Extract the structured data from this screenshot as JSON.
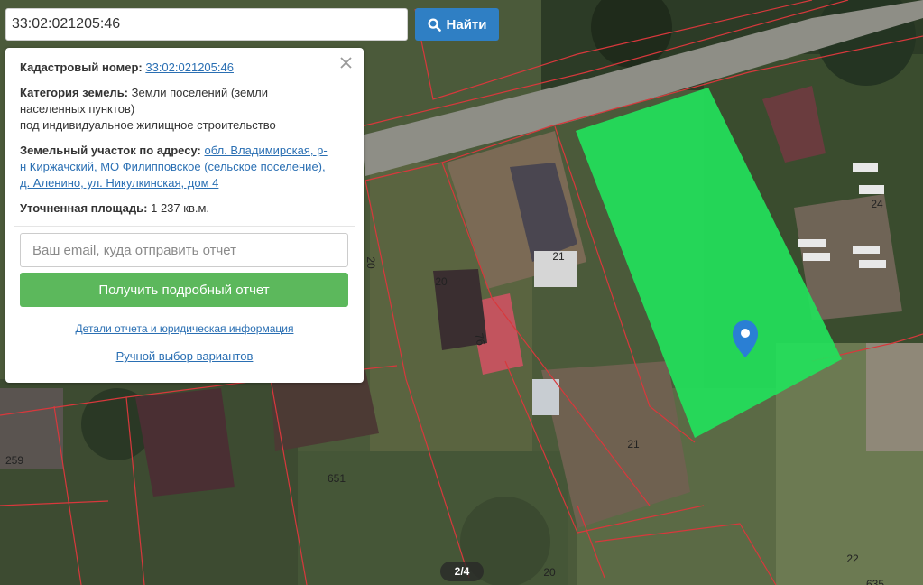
{
  "search": {
    "value": "33:02:021205:46",
    "button_label": "Найти"
  },
  "panel": {
    "cadastral_label": "Кадастровый номер:",
    "cadastral_value": "33:02:021205:46",
    "category_label": "Категория земель:",
    "category_value_line1": "Земли поселений (земли",
    "category_value_line2": "населенных пунктов)",
    "category_value_line3": "под индивидуальное жилищное строительство",
    "address_label": "Земельный участок по адресу:",
    "address_line1": "обл. Владимирская, р-",
    "address_line2": "н Киржачский, МО Филипповское (сельское поселение),",
    "address_line3": "д. Аленино, ул. Никулкинская, дом 4",
    "area_label": "Уточненная площадь:",
    "area_value": "1 237 кв.м.",
    "email_placeholder": "Ваш email, куда отправить отчет",
    "report_button": "Получить подробный отчет",
    "details_link": "Детали отчета и юридическая информация",
    "manual_link": "Ручной выбор вариантов"
  },
  "map": {
    "plot_labels": [
      "21",
      "20",
      "20",
      "21",
      "24",
      "7б",
      "651",
      "259",
      "20",
      "22",
      "635"
    ],
    "highlight_color": "#22e05a",
    "pin_color": "#2a7fd4"
  },
  "pager": {
    "text": "2/4"
  }
}
